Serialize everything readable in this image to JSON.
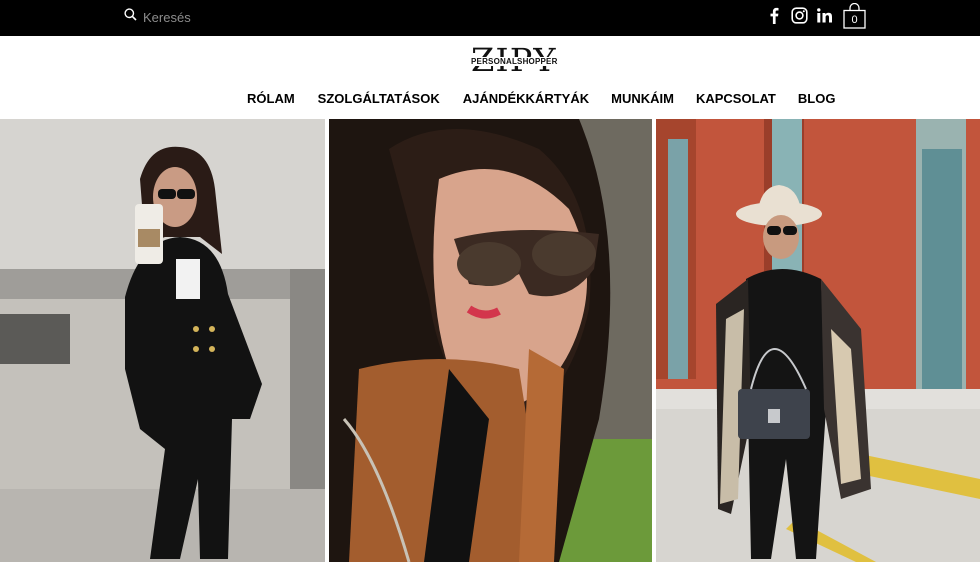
{
  "topbar": {
    "search": {
      "placeholder": "Keresés",
      "icon": "search-icon"
    },
    "socials": [
      {
        "name": "facebook",
        "icon": "facebook-icon"
      },
      {
        "name": "instagram",
        "icon": "instagram-icon"
      },
      {
        "name": "linkedin",
        "icon": "linkedin-icon"
      }
    ],
    "cart": {
      "count": "0",
      "icon": "shopping-bag-icon"
    }
  },
  "header": {
    "logo": {
      "main": "ZIPY",
      "sub": "PERSONALSHOPPER"
    },
    "nav": [
      {
        "label": "RÓLAM"
      },
      {
        "label": "SZOLGÁLTATÁSOK"
      },
      {
        "label": "AJÁNDÉKKÁRTYÁK"
      },
      {
        "label": "MUNKÁIM"
      },
      {
        "label": "KAPCSOLAT"
      },
      {
        "label": "BLOG"
      }
    ]
  },
  "colors": {
    "topbar_bg": "#000000",
    "header_bg": "#ffffff",
    "text": "#000000"
  }
}
